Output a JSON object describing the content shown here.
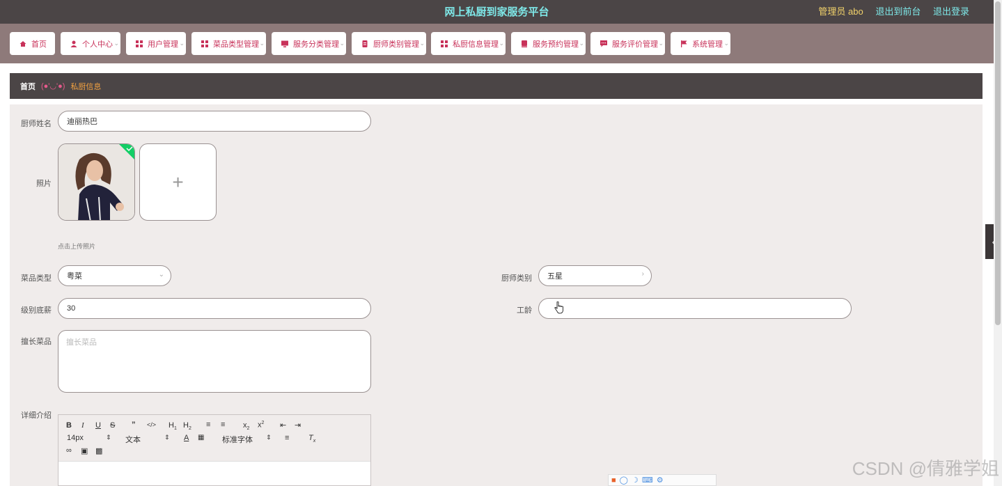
{
  "header": {
    "title": "网上私厨到家服务平台",
    "admin": "管理员 abo",
    "frontend_link": "退出到前台",
    "logout_link": "退出登录"
  },
  "nav": {
    "items": [
      {
        "label": "首页",
        "icon": "home-icon"
      },
      {
        "label": "个人中心",
        "icon": "user-icon"
      },
      {
        "label": "用户管理",
        "icon": "grid-icon"
      },
      {
        "label": "菜品类型管理",
        "icon": "grid-icon"
      },
      {
        "label": "服务分类管理",
        "icon": "monitor-icon"
      },
      {
        "label": "厨师类别管理",
        "icon": "document-icon"
      },
      {
        "label": "私厨信息管理",
        "icon": "grid-icon"
      },
      {
        "label": "服务预约管理",
        "icon": "book-icon"
      },
      {
        "label": "服务评价管理",
        "icon": "chat-icon"
      },
      {
        "label": "系统管理",
        "icon": "flag-icon"
      }
    ]
  },
  "breadcrumb": {
    "home": "首页",
    "separator": "(●'◡'●)",
    "current": "私厨信息"
  },
  "form": {
    "chef_name_label": "厨师姓名",
    "chef_name_value": "迪丽热巴",
    "photo_label": "照片",
    "upload_hint": "点击上传照片",
    "dish_type_label": "菜品类型",
    "dish_type_value": "粤菜",
    "chef_category_label": "厨师类别",
    "chef_category_value": "五星",
    "base_salary_label": "级别底薪",
    "base_salary_value": "30",
    "work_years_label": "工龄",
    "specialty_label": "擅长菜品",
    "specialty_placeholder": "擅长菜品",
    "detail_label": "详细介绍"
  },
  "editor": {
    "font_size": "14px",
    "text_style": "文本",
    "font_family": "标准字体"
  },
  "watermark": "CSDN @倩雅学姐",
  "colors": {
    "topbar": "#4b4546",
    "nav": "#8e7a7a",
    "nav_text": "#c8325a",
    "title": "#7ee8e8",
    "form_bg": "#f0eceb"
  }
}
